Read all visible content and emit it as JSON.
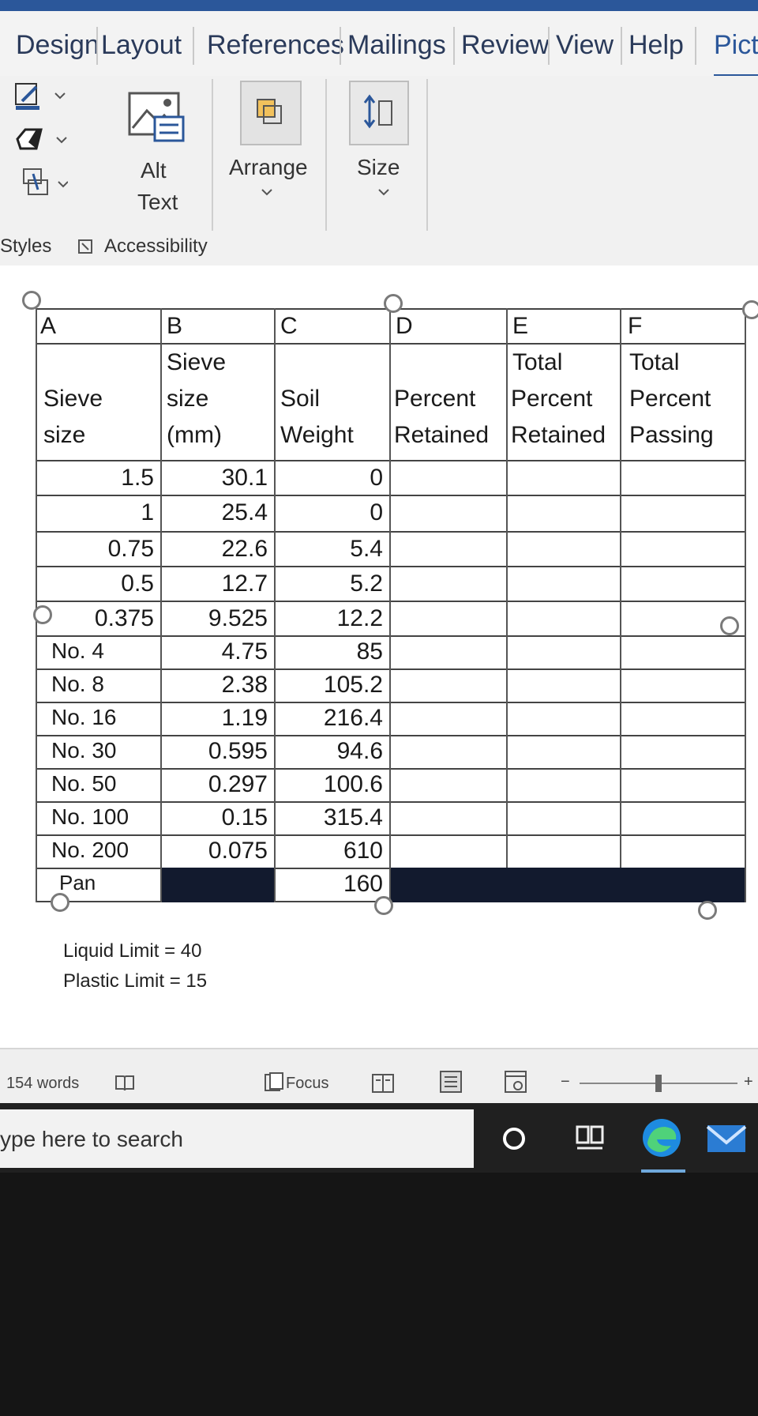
{
  "ribbon": {
    "tabs": [
      "Design",
      "Layout",
      "References",
      "Mailings",
      "Review",
      "View",
      "Help",
      "Pict"
    ],
    "alt_text_line1": "Alt",
    "alt_text_line2": "Text",
    "arrange_label": "Arrange",
    "size_label": "Size",
    "styles_group": "Styles",
    "accessibility_group": "Accessibility"
  },
  "table": {
    "column_letters": [
      "A",
      "B",
      "C",
      "D",
      "E",
      "F"
    ],
    "headers": {
      "a": [
        "Sieve",
        "size"
      ],
      "b": [
        "Sieve",
        "size",
        "(mm)"
      ],
      "c": [
        "Soil",
        "Weight"
      ],
      "d": [
        "Percent",
        "Retained"
      ],
      "e": [
        "Total",
        "Percent",
        "Retained"
      ],
      "f": [
        "Total",
        "Percent",
        "Passing"
      ]
    },
    "rows": [
      {
        "a": "1.5",
        "b": "30.1",
        "c": "0"
      },
      {
        "a": "1",
        "b": "25.4",
        "c": "0"
      },
      {
        "a": "0.75",
        "b": "22.6",
        "c": "5.4"
      },
      {
        "a": "0.5",
        "b": "12.7",
        "c": "5.2"
      },
      {
        "a": "0.375",
        "b": "9.525",
        "c": "12.2"
      },
      {
        "a": "No. 4",
        "b": "4.75",
        "c": "85"
      },
      {
        "a": "No. 8",
        "b": "2.38",
        "c": "105.2"
      },
      {
        "a": "No. 16",
        "b": "1.19",
        "c": "216.4"
      },
      {
        "a": "No. 30",
        "b": "0.595",
        "c": "94.6"
      },
      {
        "a": "No. 50",
        "b": "0.297",
        "c": "100.6"
      },
      {
        "a": "No. 100",
        "b": "0.15",
        "c": "315.4"
      },
      {
        "a": "No. 200",
        "b": "0.075",
        "c": "610"
      },
      {
        "a": "Pan",
        "b": "",
        "c": "160"
      }
    ]
  },
  "notes": {
    "liquid_limit": "Liquid Limit = 40",
    "plastic_limit": "Plastic Limit = 15"
  },
  "status": {
    "word_count": "154 words",
    "focus": "Focus"
  },
  "taskbar": {
    "search_placeholder": "ype here to search"
  },
  "colors": {
    "accent": "#2b579a",
    "filled_cell": "#121a2e"
  }
}
